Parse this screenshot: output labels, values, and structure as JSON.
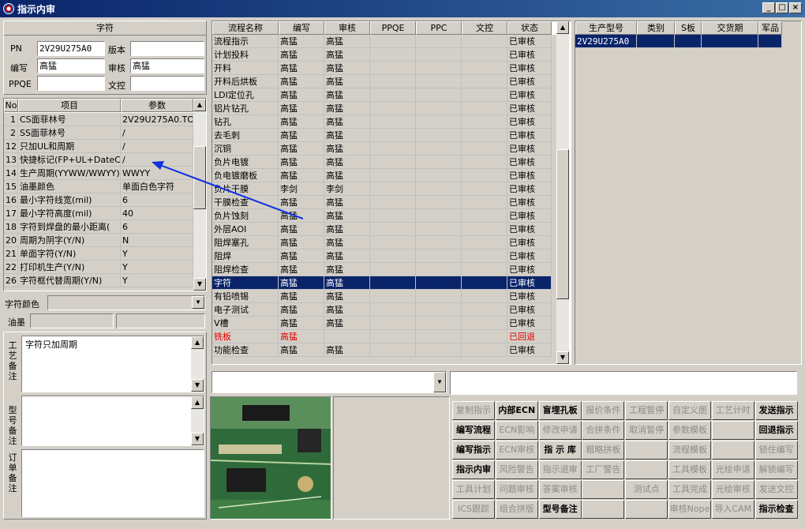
{
  "window": {
    "title": "指示内审"
  },
  "zifu": {
    "title": "字符",
    "pn_label": "PN",
    "pn_value": "2V29U275A0",
    "version_label": "版本",
    "version_value": "",
    "author_label": "编写",
    "author_value": "高猛",
    "review_label": "审核",
    "review_value": "高猛",
    "ppqe_label": "PPQE",
    "ppqe_value": "",
    "doc_label": "文控",
    "doc_value": ""
  },
  "params": {
    "headers": [
      "No",
      "项目",
      "参数"
    ],
    "rows": [
      [
        "1",
        "CS面菲林号",
        "2V29U275A0.TO"
      ],
      [
        "2",
        "SS面菲林号",
        "/"
      ],
      [
        "12",
        "只加UL和周期",
        "/"
      ],
      [
        "13",
        "快捷标记(FP+UL+DateCo",
        "/"
      ],
      [
        "14",
        "生产周期(YYWW/WWYY)",
        "WWYY"
      ],
      [
        "15",
        "油墨颜色",
        "单面白色字符"
      ],
      [
        "16",
        "最小字符线宽(mil)",
        "6"
      ],
      [
        "17",
        "最小字符高度(mil)",
        "40"
      ],
      [
        "18",
        "字符到焊盘的最小距离(",
        "6"
      ],
      [
        "20",
        "周期为阴字(Y/N)",
        "N"
      ],
      [
        "21",
        "单面字符(Y/N)",
        "Y"
      ],
      [
        "22",
        "打印机生产(Y/N)",
        "Y"
      ],
      [
        "26",
        "字符框代替周期(Y/N)",
        "Y"
      ]
    ]
  },
  "char_color_label": "字符颜色",
  "ink_label": "油墨",
  "notes": {
    "process_label": "工艺备注",
    "process_text": "字符只加周期",
    "model_label": "型号备注",
    "model_text": "",
    "order_label": "订单备注",
    "order_text": ""
  },
  "flow": {
    "headers": [
      "流程名称",
      "编写",
      "审核",
      "PPQE",
      "PPC",
      "文控",
      "状态"
    ],
    "rows": [
      [
        "流程指示",
        "高猛",
        "高猛",
        "",
        "",
        "",
        "已审核"
      ],
      [
        "计划投料",
        "高猛",
        "高猛",
        "",
        "",
        "",
        "已审核"
      ],
      [
        "开料",
        "高猛",
        "高猛",
        "",
        "",
        "",
        "已审核"
      ],
      [
        "开料后烘板",
        "高猛",
        "高猛",
        "",
        "",
        "",
        "已审核"
      ],
      [
        "LDI定位孔",
        "高猛",
        "高猛",
        "",
        "",
        "",
        "已审核"
      ],
      [
        "铝片钻孔",
        "高猛",
        "高猛",
        "",
        "",
        "",
        "已审核"
      ],
      [
        "钻孔",
        "高猛",
        "高猛",
        "",
        "",
        "",
        "已审核"
      ],
      [
        "去毛刺",
        "高猛",
        "高猛",
        "",
        "",
        "",
        "已审核"
      ],
      [
        "沉铜",
        "高猛",
        "高猛",
        "",
        "",
        "",
        "已审核"
      ],
      [
        "负片电镀",
        "高猛",
        "高猛",
        "",
        "",
        "",
        "已审核"
      ],
      [
        "负电镀磨板",
        "高猛",
        "高猛",
        "",
        "",
        "",
        "已审核"
      ],
      [
        "负片干膜",
        "李剑",
        "李剑",
        "",
        "",
        "",
        "已审核"
      ],
      [
        "干膜检查",
        "高猛",
        "高猛",
        "",
        "",
        "",
        "已审核"
      ],
      [
        "负片蚀刻",
        "高猛",
        "高猛",
        "",
        "",
        "",
        "已审核"
      ],
      [
        "外层AOI",
        "高猛",
        "高猛",
        "",
        "",
        "",
        "已审核"
      ],
      [
        "阻焊塞孔",
        "高猛",
        "高猛",
        "",
        "",
        "",
        "已审核"
      ],
      [
        "阻焊",
        "高猛",
        "高猛",
        "",
        "",
        "",
        "已审核"
      ],
      [
        "阻焊检查",
        "高猛",
        "高猛",
        "",
        "",
        "",
        "已审核"
      ],
      [
        "字符",
        "高猛",
        "高猛",
        "",
        "",
        "",
        "已审核"
      ],
      [
        "有铅喷锡",
        "高猛",
        "高猛",
        "",
        "",
        "",
        "已审核"
      ],
      [
        "电子测试",
        "高猛",
        "高猛",
        "",
        "",
        "",
        "已审核"
      ],
      [
        "V槽",
        "高猛",
        "高猛",
        "",
        "",
        "",
        "已审核"
      ],
      [
        "铣板",
        "高猛",
        "",
        "",
        "",
        "",
        "已回退"
      ],
      [
        "功能检查",
        "高猛",
        "高猛",
        "",
        "",
        "",
        "已审核"
      ]
    ]
  },
  "models": {
    "headers": [
      "生产型号",
      "类别",
      "S板",
      "交货期",
      "军品"
    ],
    "rows": [
      [
        "2V29U275A0",
        "",
        "",
        "",
        ""
      ]
    ]
  },
  "buttons": [
    [
      "复制指示",
      "内部ECN",
      "盲埋孔板",
      "报价条件",
      "工程暂停",
      "自定义图",
      "工艺计时",
      "发送指示"
    ],
    [
      "编写流程",
      "ECN影响",
      "修改申请",
      "合拼条件",
      "取消暂停",
      "参数模板",
      "",
      "回退指示"
    ],
    [
      "编写指示",
      "ECN审核",
      "指 示 库",
      "粗略拼板",
      "",
      "流程模板",
      "",
      "锁住编写"
    ],
    [
      "指示内审",
      "风险警告",
      "指示退审",
      "工厂警告",
      "",
      "工具模板",
      "光绘申请",
      "解锁编写"
    ],
    [
      "工具计划",
      "问题审核",
      "答案审核",
      "",
      "测试点",
      "工具完成",
      "光绘审核",
      "发送文控"
    ],
    [
      "ICS跟踪",
      "组合拼版",
      "型号备注",
      "",
      "",
      "审核Nope",
      "导入CAM",
      "指示检查"
    ]
  ],
  "enabled_buttons": [
    "内部ECN",
    "盲埋孔板",
    "发送指示",
    "编写流程",
    "回退指示",
    "编写指示",
    "指 示 库",
    "指示内审",
    "型号备注",
    "指示检查"
  ]
}
